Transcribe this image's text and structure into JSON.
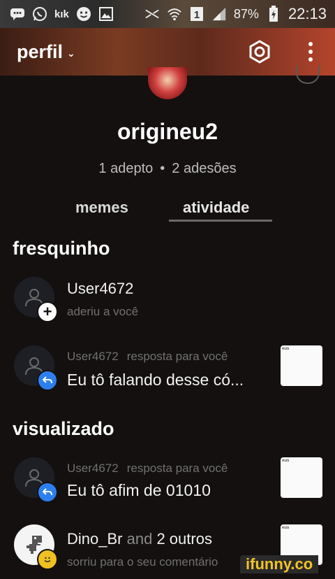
{
  "status_bar": {
    "kik": "kık",
    "battery": "87%",
    "time": "22:13",
    "sim": "1"
  },
  "header": {
    "title": "perfil",
    "chevron": "⌄",
    "settings_icon": "hexagon-settings-icon",
    "more_icon": "more-vert-icon"
  },
  "profile": {
    "username": "origineu2",
    "followers": "1 adepto",
    "separator": "•",
    "following": "2 adesões"
  },
  "tabs": [
    {
      "label": "memes"
    },
    {
      "label": "atividade"
    }
  ],
  "sections": {
    "fresh": "fresquinho",
    "viewed": "visualizado"
  },
  "notifications": [
    {
      "user": "User4672",
      "action": "aderiu a você",
      "text": "",
      "thumb_text": ""
    },
    {
      "user": "User4672",
      "action": "resposta para você",
      "text": "Eu tô falando desse có...",
      "thumb_text": "eus"
    },
    {
      "user": "User4672",
      "action": "resposta para você",
      "text": "Eu tô afim de 01010",
      "thumb_text": "eus"
    },
    {
      "user": "Dino_Br",
      "and": "and",
      "others": "2 outros",
      "action": "sorriu para o seu comentário",
      "thumb_text": "eus"
    }
  ],
  "watermark": "ifunny.co",
  "colors": {
    "accent_blue": "#2d7ff0",
    "accent_yellow": "#f3c326",
    "header_red": "#b4442c",
    "background": "#141010"
  }
}
